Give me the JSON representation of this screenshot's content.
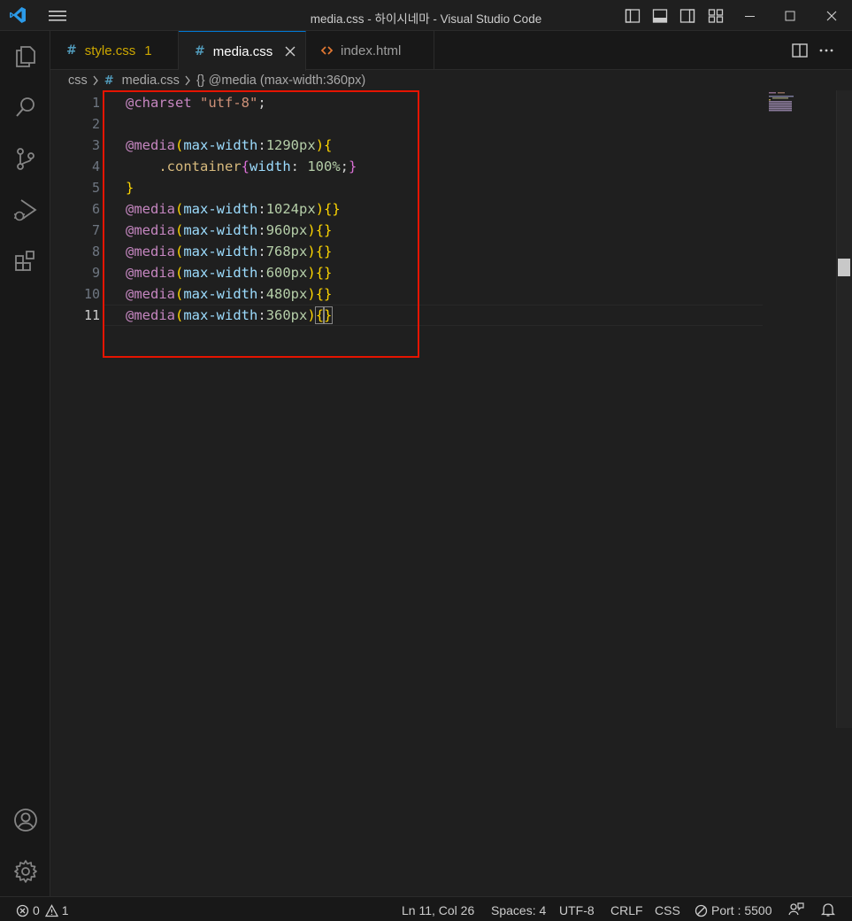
{
  "window": {
    "title": "media.css - 하이시네마 - Visual Studio Code"
  },
  "tabs": [
    {
      "name": "style.css",
      "badge": "1",
      "active": false
    },
    {
      "name": "media.css",
      "active": true
    },
    {
      "name": "index.html",
      "active": false
    }
  ],
  "breadcrumb": {
    "folder": "css",
    "file": "media.css",
    "symbol": "{} @media (max-width:360px)"
  },
  "editor": {
    "current_line": 11,
    "line_numbers": [
      "1",
      "2",
      "3",
      "4",
      "5",
      "6",
      "7",
      "8",
      "9",
      "10",
      "11"
    ],
    "code": {
      "l1": {
        "at": "@charset",
        "str": "\"utf-8\"",
        "semi": ";"
      },
      "l3": {
        "at": "@media",
        "prop": "max-width",
        "num": "1290px"
      },
      "l4": {
        "indent": "    ",
        "sel": ".container",
        "prop": "width",
        "colon": ": ",
        "num": "100%",
        "semi": ";"
      },
      "rows": [
        {
          "at": "@media",
          "prop": "max-width",
          "num": "1024px"
        },
        {
          "at": "@media",
          "prop": "max-width",
          "num": "960px"
        },
        {
          "at": "@media",
          "prop": "max-width",
          "num": "768px"
        },
        {
          "at": "@media",
          "prop": "max-width",
          "num": "600px"
        },
        {
          "at": "@media",
          "prop": "max-width",
          "num": "480px"
        },
        {
          "at": "@media",
          "prop": "max-width",
          "num": "360px"
        }
      ]
    }
  },
  "statusbar": {
    "errors": "0",
    "warnings": "1",
    "position": "Ln 11, Col 26",
    "spaces": "Spaces: 4",
    "encoding": "UTF-8",
    "eol": "CRLF",
    "language": "CSS",
    "port": "Port : 5500"
  },
  "icons": {
    "activity": [
      "explorer-icon",
      "search-icon",
      "source-control-icon",
      "run-debug-icon",
      "extensions-icon",
      "account-icon",
      "settings-gear-icon"
    ]
  },
  "colors": {
    "keyword": "#c586c0",
    "string": "#ce9178",
    "property": "#9cdcfe",
    "number": "#b5cea8",
    "selector": "#d7ba7d",
    "bracket1": "#ffd700",
    "bracket2": "#da70d6",
    "highlight_box": "#e51400",
    "active_tab_border": "#0078d4"
  }
}
